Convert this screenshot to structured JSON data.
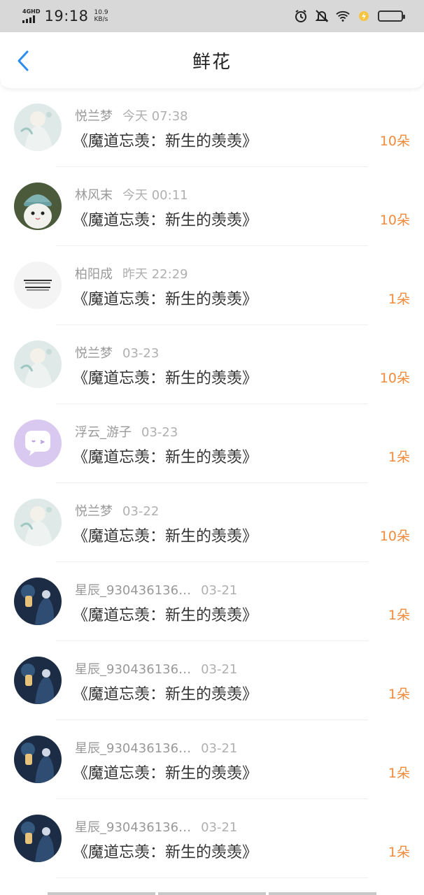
{
  "status_bar": {
    "network": "4GHD",
    "time": "19:18",
    "speed_value": "10.9",
    "speed_unit": "KB/s"
  },
  "header": {
    "title": "鲜花",
    "back_icon": "chevron-left-icon"
  },
  "colors": {
    "accent": "#2d8cf0",
    "count": "#f08a3c"
  },
  "items": [
    {
      "user": "悦兰梦",
      "time": "今天 07:38",
      "book": "《魔道忘羡：新生的羡羡》",
      "count": "10朵",
      "avatar": "anime-girl-white"
    },
    {
      "user": "林风末",
      "time": "今天 00:11",
      "book": "《魔道忘羡：新生的羡羡》",
      "count": "10朵",
      "avatar": "cat-hat"
    },
    {
      "user": "柏阳成",
      "time": "昨天 22:29",
      "book": "《魔道忘羡：新生的羡羡》",
      "count": "1朵",
      "avatar": "text-image"
    },
    {
      "user": "悦兰梦",
      "time": "03-23",
      "book": "《魔道忘羡：新生的羡羡》",
      "count": "10朵",
      "avatar": "anime-girl-white"
    },
    {
      "user": "浮云_游子",
      "time": "03-23",
      "book": "《魔道忘羡：新生的羡羡》",
      "count": "1朵",
      "avatar": "purple-chat"
    },
    {
      "user": "悦兰梦",
      "time": "03-22",
      "book": "《魔道忘羡：新生的羡羡》",
      "count": "10朵",
      "avatar": "anime-girl-white"
    },
    {
      "user": "星辰_930436136…",
      "time": "03-21",
      "book": "《魔道忘羡：新生的羡羡》",
      "count": "1朵",
      "avatar": "night-lantern"
    },
    {
      "user": "星辰_930436136…",
      "time": "03-21",
      "book": "《魔道忘羡：新生的羡羡》",
      "count": "1朵",
      "avatar": "night-lantern"
    },
    {
      "user": "星辰_930436136…",
      "time": "03-21",
      "book": "《魔道忘羡：新生的羡羡》",
      "count": "1朵",
      "avatar": "night-lantern"
    },
    {
      "user": "星辰_930436136…",
      "time": "03-21",
      "book": "《魔道忘羡：新生的羡羡》",
      "count": "1朵",
      "avatar": "night-lantern"
    }
  ]
}
